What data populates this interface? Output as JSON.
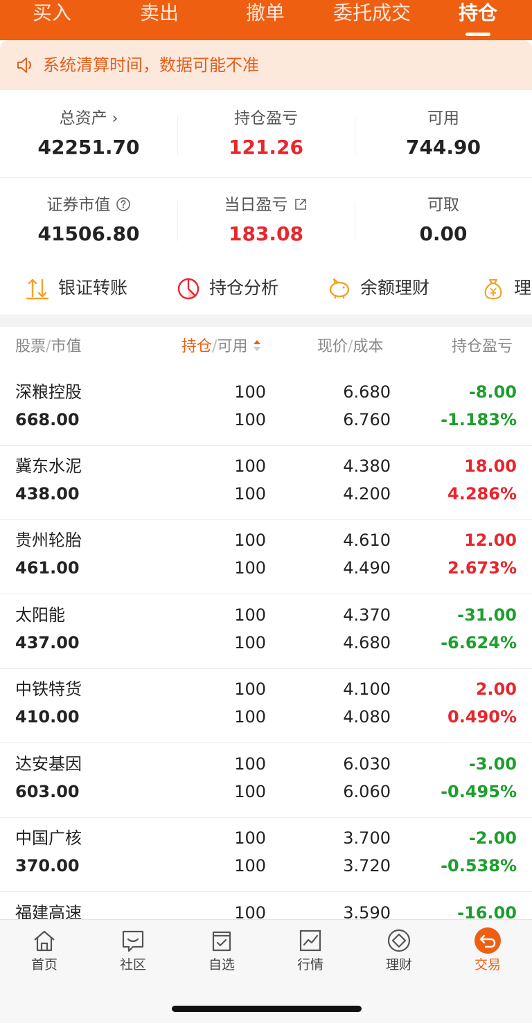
{
  "top_tabs": [
    "买入",
    "卖出",
    "撤单",
    "委托成交",
    "持仓"
  ],
  "active_tab": "持仓",
  "notice": {
    "text": "系统清算时间，数据可能不准"
  },
  "summary": {
    "total_assets": {
      "label": "总资产",
      "value": "42251.70"
    },
    "position_pl": {
      "label": "持仓盈亏",
      "value": "121.26"
    },
    "available": {
      "label": "可用",
      "value": "744.90"
    },
    "market_value": {
      "label": "证券市值",
      "value": "41506.80"
    },
    "daily_pl": {
      "label": "当日盈亏",
      "value": "183.08"
    },
    "withdrawable": {
      "label": "可取",
      "value": "0.00"
    }
  },
  "actions": [
    "银证转账",
    "持仓分析",
    "余额理财",
    "理财"
  ],
  "table_header": {
    "col1_a": "股票",
    "col1_b": "市值",
    "col2_a": "持仓",
    "col2_b": "可用",
    "col3_a": "现价",
    "col3_b": "成本",
    "col4": "持仓盈亏"
  },
  "positions": [
    {
      "name": "深粮控股",
      "market_value": "668.00",
      "holding": "100",
      "available": "100",
      "price": "6.680",
      "cost": "6.760",
      "pl": "-8.00",
      "pl_pct": "-1.183%",
      "trend": "down"
    },
    {
      "name": "冀东水泥",
      "market_value": "438.00",
      "holding": "100",
      "available": "100",
      "price": "4.380",
      "cost": "4.200",
      "pl": "18.00",
      "pl_pct": "4.286%",
      "trend": "up"
    },
    {
      "name": "贵州轮胎",
      "market_value": "461.00",
      "holding": "100",
      "available": "100",
      "price": "4.610",
      "cost": "4.490",
      "pl": "12.00",
      "pl_pct": "2.673%",
      "trend": "up"
    },
    {
      "name": "太阳能",
      "market_value": "437.00",
      "holding": "100",
      "available": "100",
      "price": "4.370",
      "cost": "4.680",
      "pl": "-31.00",
      "pl_pct": "-6.624%",
      "trend": "down"
    },
    {
      "name": "中铁特货",
      "market_value": "410.00",
      "holding": "100",
      "available": "100",
      "price": "4.100",
      "cost": "4.080",
      "pl": "2.00",
      "pl_pct": "0.490%",
      "trend": "up"
    },
    {
      "name": "达安基因",
      "market_value": "603.00",
      "holding": "100",
      "available": "100",
      "price": "6.030",
      "cost": "6.060",
      "pl": "-3.00",
      "pl_pct": "-0.495%",
      "trend": "down"
    },
    {
      "name": "中国广核",
      "market_value": "370.00",
      "holding": "100",
      "available": "100",
      "price": "3.700",
      "cost": "3.720",
      "pl": "-2.00",
      "pl_pct": "-0.538%",
      "trend": "down"
    },
    {
      "name": "福建高速",
      "market_value": "",
      "holding": "100",
      "available": "",
      "price": "3.590",
      "cost": "",
      "pl": "-16.00",
      "pl_pct": "",
      "trend": "down"
    }
  ],
  "bottom_nav": [
    "首页",
    "社区",
    "自选",
    "行情",
    "理财",
    "交易"
  ],
  "active_nav": "交易",
  "colors": {
    "brand": "#EE5F12",
    "up": "#E8262D",
    "down": "#1E9E2E"
  }
}
